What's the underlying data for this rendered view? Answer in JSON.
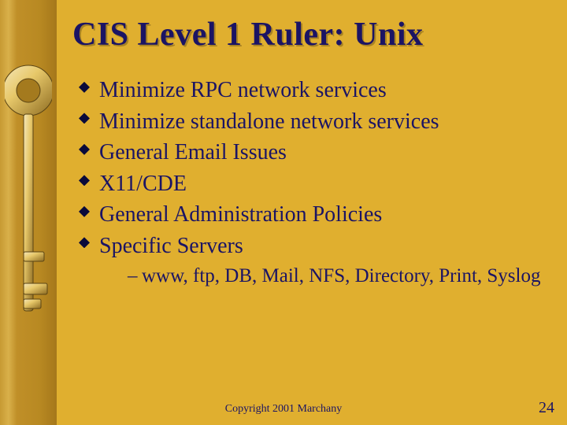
{
  "title": "CIS Level 1 Ruler: Unix",
  "bullets": {
    "b0": "Minimize RPC network services",
    "b1": "Minimize standalone network services",
    "b2": "General Email Issues",
    "b3": "X11/CDE",
    "b4": "General Administration Policies",
    "b5": "Specific Servers"
  },
  "sub": {
    "s0": "www, ftp, DB, Mail, NFS, Directory, Print, Syslog"
  },
  "footer": "Copyright 2001 Marchany",
  "slide_number": "24"
}
